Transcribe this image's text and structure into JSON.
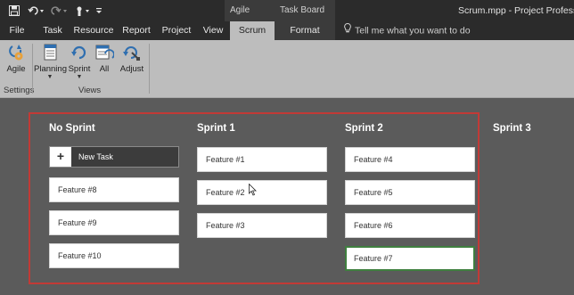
{
  "title_bar": {
    "context_tabs": [
      "Agile Tools",
      "Task Board Tools"
    ],
    "document_title": "Scrum.mpp - Project Professional",
    "qat_icons": [
      "save-icon",
      "undo-icon",
      "redo-icon",
      "touch-mode-icon",
      "customize-qat-icon"
    ]
  },
  "tabs": [
    {
      "label": "File"
    },
    {
      "label": "Task"
    },
    {
      "label": "Resource"
    },
    {
      "label": "Report"
    },
    {
      "label": "Project"
    },
    {
      "label": "View"
    },
    {
      "label": "Scrum",
      "active": true
    },
    {
      "label": "Format"
    }
  ],
  "tell_me": {
    "placeholder": "Tell me what you want to do",
    "icon": "lightbulb-icon"
  },
  "ribbon": {
    "groups": [
      {
        "label": "Settings",
        "buttons": [
          {
            "label": "Agile",
            "icon": "agile-settings-icon"
          }
        ]
      },
      {
        "label": "Views",
        "buttons": [
          {
            "label": "Planning",
            "icon": "planning-icon",
            "dropdown": true
          },
          {
            "label": "Sprint",
            "icon": "sprint-icon",
            "dropdown": true
          },
          {
            "label": "All",
            "icon": "all-icon"
          },
          {
            "label": "Adjust",
            "icon": "adjust-icon"
          }
        ]
      }
    ]
  },
  "board": {
    "new_task_label": "New Task",
    "columns": [
      {
        "title": "No Sprint",
        "cards": [
          "Feature #8",
          "Feature #9",
          "Feature #10"
        ]
      },
      {
        "title": "Sprint 1",
        "cards": [
          "Feature #1",
          "Feature #2",
          "Feature #3"
        ]
      },
      {
        "title": "Sprint 2",
        "cards": [
          "Feature #4",
          "Feature #5",
          "Feature #6",
          "Feature #7"
        ],
        "selected_card": "Feature #7"
      },
      {
        "title": "Sprint 3",
        "cards": []
      }
    ]
  },
  "colors": {
    "highlight_frame": "#c23a36",
    "board_background": "#5b5b5b",
    "selected_card_border": "#3f7f3f"
  }
}
